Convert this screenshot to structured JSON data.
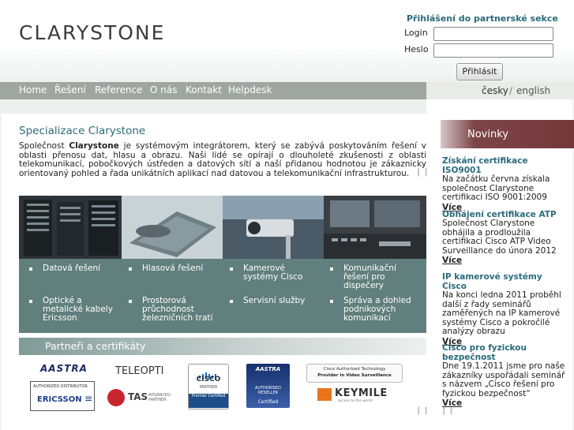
{
  "logo": {
    "text": "CLARYSTONE"
  },
  "login": {
    "title": "Přihlášení do partnerské sekce",
    "login_label": "Login",
    "password_label": "Heslo",
    "login_value": "",
    "password_value": "",
    "submit_label": "Přihlásit"
  },
  "nav": {
    "items": [
      {
        "label": "Home"
      },
      {
        "label": "Řešení"
      },
      {
        "label": "Reference"
      },
      {
        "label": "O nás"
      },
      {
        "label": "Kontakt"
      },
      {
        "label": "Helpdesk"
      }
    ]
  },
  "lang": {
    "cz": "česky",
    "sep": "/",
    "en": "english"
  },
  "main": {
    "title": "Specializace Clarystone",
    "intro_pre": "Společnost ",
    "intro_brand": "Clarystone",
    "intro_post": " je systémovým integrátorem, který se zabývá poskytováním řešení v oblasti přenosu dat, hlasu a obrazu. Naši lidé se opírají o dlouholeté zkušenosti z oblasti telekomunikací, pobočkových ústředen a datových sítí a naší přidanou hodnotou je zákaznicky orientovaný pohled a řada unikátních aplikací nad datovou a telekomunikační infrastrukturou."
  },
  "solutions": [
    {
      "label": "Datová řešení"
    },
    {
      "label": "Hlasová řešení"
    },
    {
      "label": "Kamerové systémy Cisco"
    },
    {
      "label": "Komunikační řešení pro dispečery"
    },
    {
      "label": "Optické a metalické kabely Ericsson"
    },
    {
      "label": "Prostorová průchodnost železničních tratí"
    },
    {
      "label": "Servisní služby"
    },
    {
      "label": "Správa a dohled podnikových komunikací"
    }
  ],
  "partners": {
    "title": "Partneři a certifikáty",
    "aastra": "AASTRA",
    "teleopti": "TELEOPTI",
    "cisco": "CISCO",
    "cisco_partner": "PARTNER",
    "cisco_premier": "Premier Certified",
    "aastra_reseller": "AUTHORISED RESELLER",
    "aastra_certified": "Certified",
    "cisco_video_1": "Cisco Authorized Technology",
    "cisco_video_2": "Provider in Video Surveillance",
    "ericsson_small": "AUTHORIZED DISTRIBUTOR",
    "ericsson": "ERICSSON",
    "tas": "TAS",
    "tas_sub": "ADVANCED PARTNER",
    "keymile": "KEYMILE",
    "keymile_sub": "access to the world"
  },
  "side": {
    "title": "Novinky",
    "news": [
      {
        "title": "Získání certifikace ISO9001",
        "body": "Na začátku června získala společnost Clarystone certifikaci ISO 9001:2009",
        "more": "Více"
      },
      {
        "title": "Obhájení certifikace ATP",
        "body": "Společnost Clarystone obhájila a prodloužila certifikaci Cisco ATP Video Surveillance do února 2012",
        "more": "Více"
      },
      {
        "title": "IP kamerové systémy Cisco",
        "body": "Na konci ledna 2011 proběhl další z řady seminářů zaměřených na IP kamerové systémy Cisco a pokročilé analýzy obrazu",
        "more": "Více"
      },
      {
        "title": "Cisco pro fyzickou bezpečnost",
        "body": "Dne 19.1.2011 jsme pro naše zákazníky uspořádali seminář s názvem „Cisco řešení pro fyzickou bezpečnost“",
        "more": "Více"
      }
    ]
  }
}
